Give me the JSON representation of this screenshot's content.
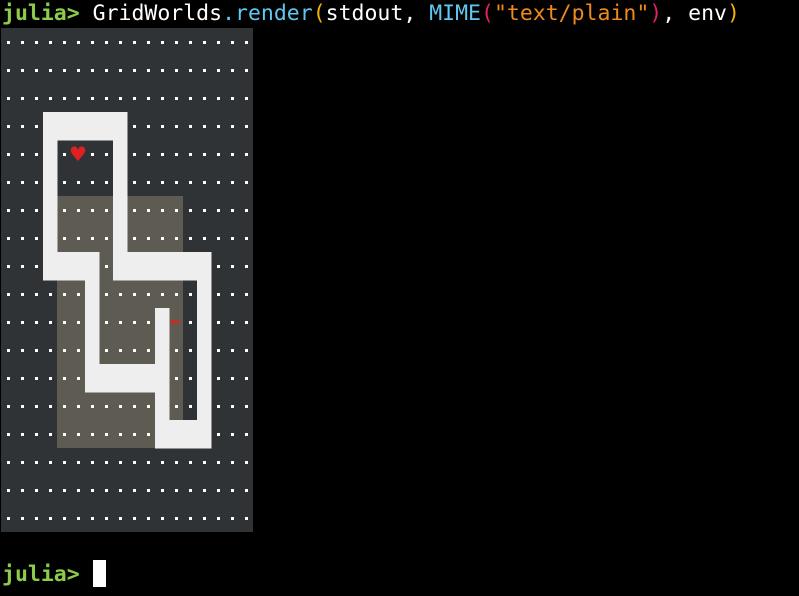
{
  "terminal": {
    "prompt": "julia>",
    "command": {
      "module": "GridWorlds",
      "dot": ".",
      "func": "render",
      "open_paren": "(",
      "arg1": "stdout, ",
      "mime": "MIME",
      "mime_open": "(",
      "mime_string": "\"text/plain\"",
      "mime_close": ")",
      "rest": ", env",
      "close_paren": ")"
    },
    "prompt2": "julia>"
  },
  "colors": {
    "background": "#000000",
    "grid_background": "#2f3336",
    "dot": "#ffffff",
    "wall": "#eeeeee",
    "visible_region": "#5e5c52",
    "agent": "#e02020",
    "goal": "#e02020",
    "prompt": "#8ccc4b"
  },
  "grid": {
    "rows": 18,
    "cols": 18,
    "walls": [
      [
        3,
        3
      ],
      [
        3,
        4
      ],
      [
        3,
        5
      ],
      [
        3,
        6
      ],
      [
        3,
        7
      ],
      [
        3,
        8
      ],
      [
        4,
        3
      ],
      [
        4,
        8
      ],
      [
        5,
        3
      ],
      [
        5,
        8
      ],
      [
        6,
        3
      ],
      [
        6,
        8
      ],
      [
        7,
        3
      ],
      [
        7,
        8
      ],
      [
        8,
        3
      ],
      [
        8,
        4
      ],
      [
        8,
        5
      ],
      [
        8,
        6
      ],
      [
        8,
        8
      ],
      [
        8,
        9
      ],
      [
        8,
        10
      ],
      [
        8,
        11
      ],
      [
        8,
        12
      ],
      [
        8,
        13
      ],
      [
        8,
        14
      ],
      [
        9,
        6
      ],
      [
        9,
        14
      ],
      [
        10,
        6
      ],
      [
        10,
        11
      ],
      [
        10,
        14
      ],
      [
        11,
        6
      ],
      [
        11,
        11
      ],
      [
        11,
        14
      ],
      [
        12,
        6
      ],
      [
        12,
        7
      ],
      [
        12,
        8
      ],
      [
        12,
        9
      ],
      [
        12,
        10
      ],
      [
        12,
        11
      ],
      [
        12,
        14
      ],
      [
        13,
        11
      ],
      [
        13,
        14
      ],
      [
        14,
        11
      ],
      [
        14,
        12
      ],
      [
        14,
        13
      ],
      [
        14,
        14
      ]
    ],
    "visible_region": {
      "row_start": 6,
      "row_end": 14,
      "col_start": 4,
      "col_end": 12
    },
    "goal": {
      "row": 4,
      "col": 5,
      "icon": "heart-icon",
      "glyph": "♥"
    },
    "agent": {
      "row": 10,
      "col": 12,
      "icon": "agent-left-arrow-icon",
      "direction": "left"
    }
  }
}
